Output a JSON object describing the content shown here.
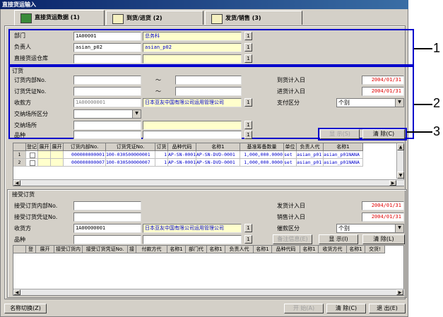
{
  "window": {
    "title": "直接货运输入"
  },
  "tabs": [
    {
      "label": "直接货运数据 (1)",
      "icon": "book-icon"
    },
    {
      "label": "到货/进货 (2)",
      "icon": "document-icon"
    },
    {
      "label": "发货/销售 (3)",
      "icon": "document-icon"
    }
  ],
  "section1": {
    "dept_label": "部门",
    "dept_code": "1A00001",
    "dept_name": "总务科",
    "person_label": "负责人",
    "person_code": "asian_p02",
    "person_name": "asian_p02",
    "warehouse_label": "直接货运仓库"
  },
  "order": {
    "title": "订货",
    "internal_no_label": "订货内部No.",
    "voucher_label": "订货凭证No.",
    "tilde": "～",
    "receiver_label": "收款方",
    "receiver_code": "1A00000001",
    "receiver_name": "日本亚友中国有限公司运用管理公司",
    "place_type_label": "交纳场所区分",
    "place_label": "交纳场所",
    "item_label": "品种",
    "arrival_plan_label": "到货计入日",
    "arrival_plan_date": "2004/01/31",
    "purchase_plan_label": "进货计入日",
    "purchase_plan_date": "2004/01/31",
    "payment_label": "支付区分",
    "payment_value": "个别",
    "display_btn": "显 示(S)",
    "clear_btn": "清 除(C)"
  },
  "grid1": {
    "headers": [
      "",
      "登记",
      "展开",
      "展开",
      "订货内部No.",
      "订货凭证No.",
      "订货",
      "品种代码",
      "名称1",
      "基准筹备数量",
      "单位",
      "负责人代",
      "名称1"
    ],
    "rows": [
      [
        "1",
        "",
        "",
        "",
        "000000000001",
        "100-030500000001",
        "1",
        "AP-SN-0001",
        "AP-SN-DVD-0001",
        "1,000,000.0000",
        "set",
        "asian_p01",
        "asian_p01NANA"
      ],
      [
        "2",
        "",
        "",
        "",
        "000000000007",
        "100-030500000007",
        "1",
        "AP-SN-0001",
        "AP-SN-DVD-0001",
        "1,000,000.0000",
        "set",
        "asian_p01",
        "asian_p01NANA"
      ]
    ]
  },
  "accept": {
    "title": "接受订货",
    "internal_no_label": "接受订货内部No.",
    "voucher_label": "接受订货凭证No.",
    "customer_label": "收货方",
    "customer_code": "1A00000001",
    "customer_name": "日本亚友中国有限公司运用管理公司",
    "item_label": "品种",
    "ship_plan_label": "发货计入日",
    "ship_plan_date": "2004/01/31",
    "sales_plan_label": "销售计入日",
    "sales_plan_date": "2004/01/31",
    "collect_label": "催款区分",
    "collect_value": "个别",
    "memo_btn": "备注信息(E)",
    "display_btn": "显 示(I)",
    "clear_btn": "清 除(L)"
  },
  "grid2": {
    "headers": [
      "",
      "登",
      "展开",
      "接受订货内",
      "接受订货凭证No.",
      "接",
      "付款方代",
      "名称1",
      "部门代",
      "名称1",
      "负责人代",
      "名称1",
      "品种代码",
      "名称1",
      "收货方代",
      "名称1",
      "交货!"
    ]
  },
  "footer": {
    "name_switch_btn": "名称切换(Z)",
    "start_btn": "开 始(A)",
    "clear_btn": "清 除(C)",
    "exit_btn": "退 出(E)"
  },
  "callouts": [
    "1",
    "2",
    "3"
  ]
}
